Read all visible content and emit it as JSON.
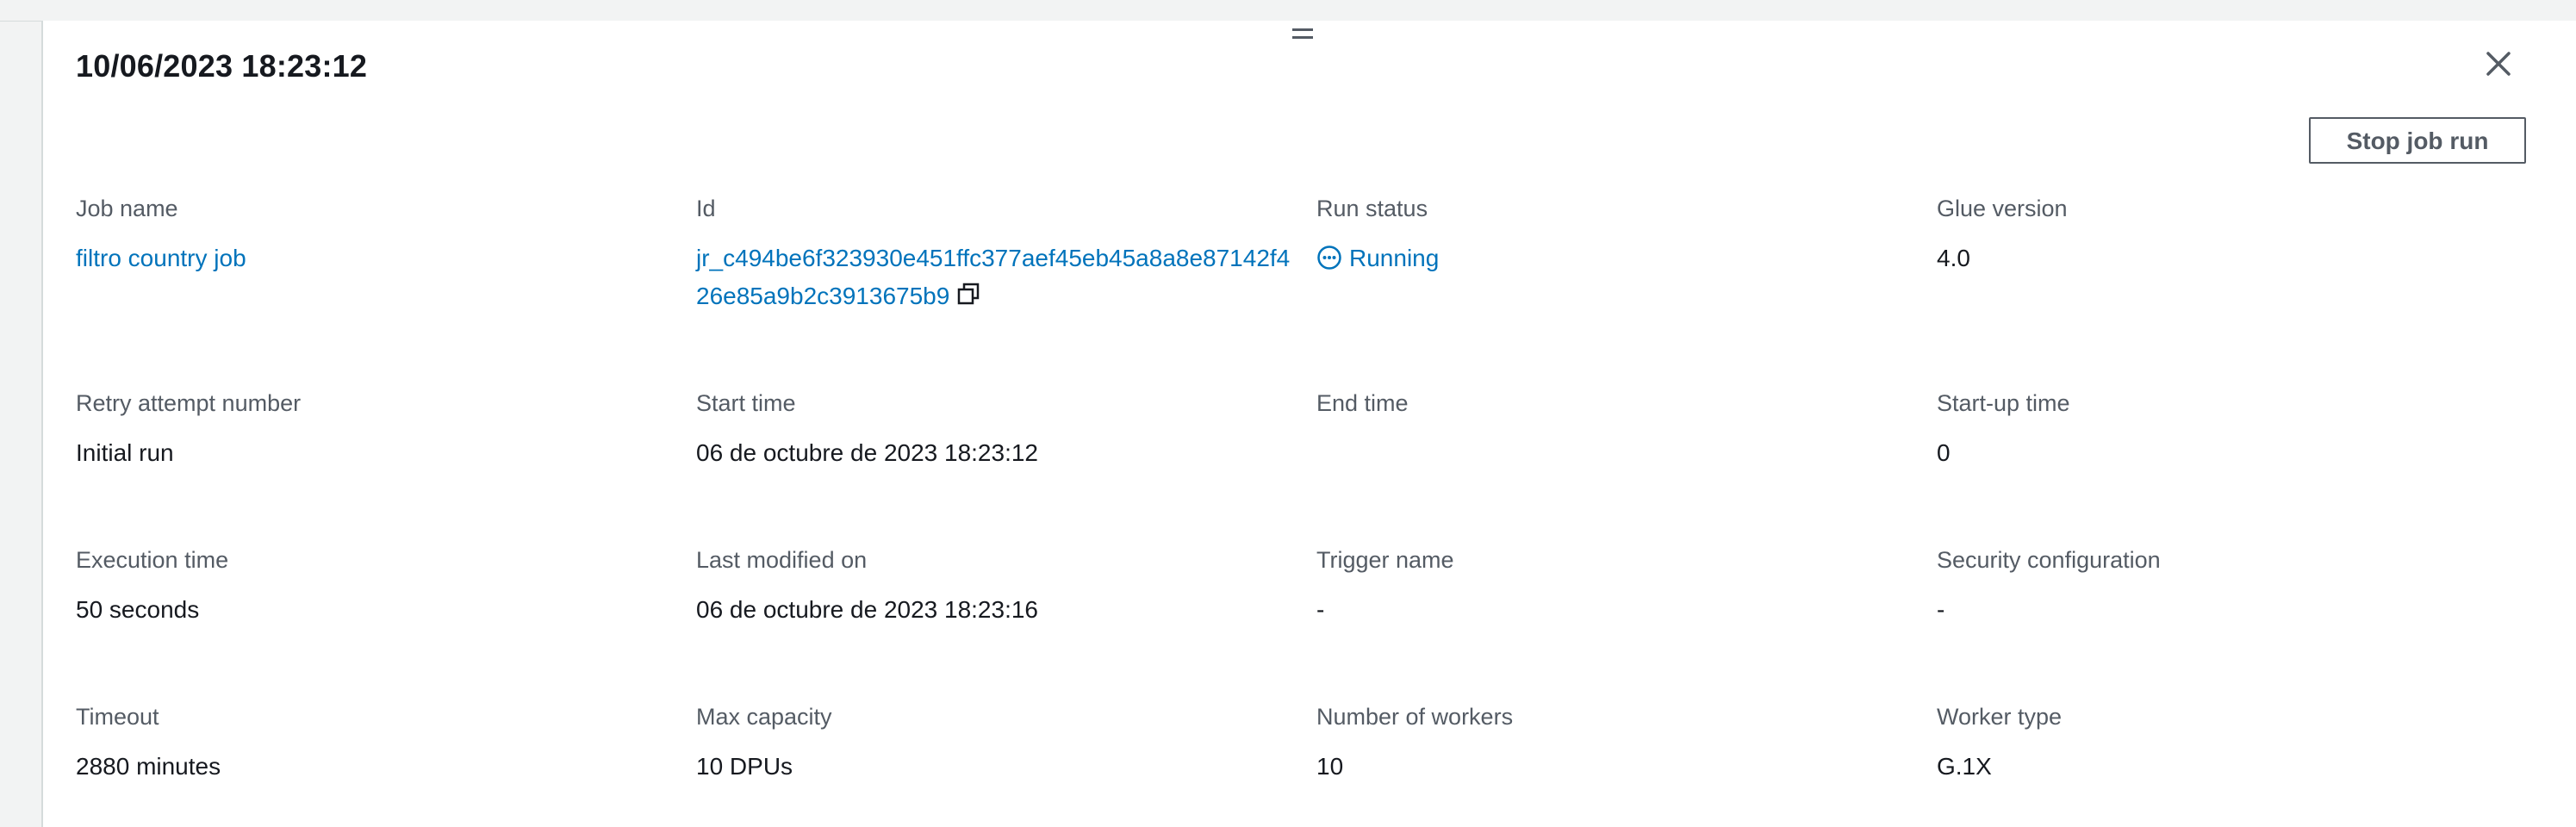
{
  "panel": {
    "title": "10/06/2023 18:23:12",
    "stop_button_label": "Stop job run"
  },
  "icons": {
    "close": "close-icon",
    "copy": "copy-icon",
    "status": "in-progress-icon",
    "drag_handle": "drag-handle-icon"
  },
  "colors": {
    "link": "#0073bb",
    "label": "#545b64",
    "text": "#16191f"
  },
  "details": {
    "job_name": {
      "label": "Job name",
      "value": "filtro country job"
    },
    "id": {
      "label": "Id",
      "value": "jr_c494be6f323930e451ffc377aef45eb45a8a8e87142f426e85a9b2c3913675b9"
    },
    "run_status": {
      "label": "Run status",
      "value": "Running"
    },
    "glue_version": {
      "label": "Glue version",
      "value": "4.0"
    },
    "retry_attempt": {
      "label": "Retry attempt number",
      "value": "Initial run"
    },
    "start_time": {
      "label": "Start time",
      "value": "06 de octubre de 2023 18:23:12"
    },
    "end_time": {
      "label": "End time",
      "value": ""
    },
    "startup_time": {
      "label": "Start-up time",
      "value": "0"
    },
    "execution_time": {
      "label": "Execution time",
      "value": "50 seconds"
    },
    "last_modified": {
      "label": "Last modified on",
      "value": "06 de octubre de 2023 18:23:16"
    },
    "trigger_name": {
      "label": "Trigger name",
      "value": "-"
    },
    "security_config": {
      "label": "Security configuration",
      "value": "-"
    },
    "timeout": {
      "label": "Timeout",
      "value": "2880 minutes"
    },
    "max_capacity": {
      "label": "Max capacity",
      "value": "10 DPUs"
    },
    "num_workers": {
      "label": "Number of workers",
      "value": "10"
    },
    "worker_type": {
      "label": "Worker type",
      "value": "G.1X"
    }
  }
}
